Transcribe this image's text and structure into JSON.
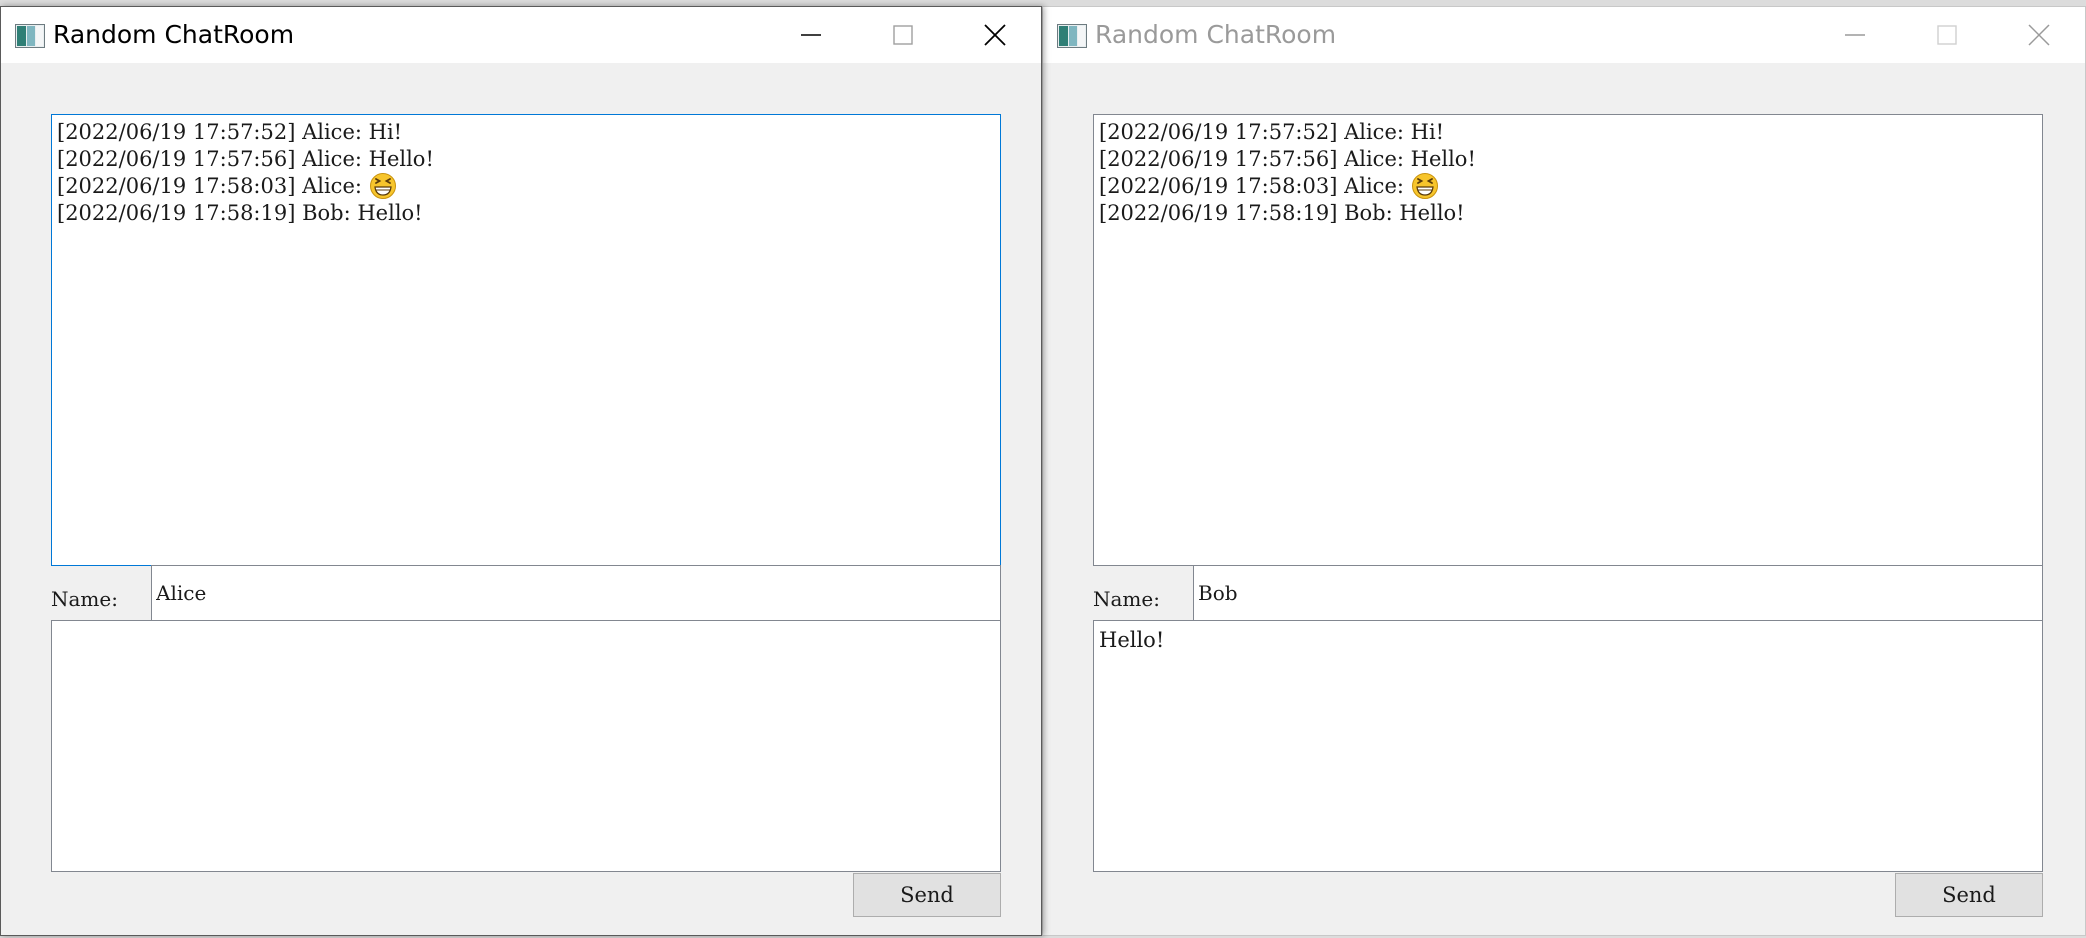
{
  "windows": {
    "alice": {
      "title": "Random ChatRoom",
      "messages": [
        {
          "text": "[2022/06/19 17:57:52] Alice: Hi!"
        },
        {
          "text": "[2022/06/19 17:57:56] Alice: Hello!"
        },
        {
          "text": "[2022/06/19 17:58:03] Alice: ",
          "emoji": "grinning-squinting-face"
        },
        {
          "text": "[2022/06/19 17:58:19] Bob: Hello!"
        }
      ],
      "name_label": "Name:",
      "name_value": "Alice",
      "compose_value": "",
      "send_label": "Send"
    },
    "bob": {
      "title": "Random ChatRoom",
      "messages": [
        {
          "text": "[2022/06/19 17:57:52] Alice: Hi!"
        },
        {
          "text": "[2022/06/19 17:57:56] Alice: Hello!"
        },
        {
          "text": "[2022/06/19 17:58:03] Alice: ",
          "emoji": "grinning-squinting-face"
        },
        {
          "text": "[2022/06/19 17:58:19] Bob: Hello!"
        }
      ],
      "name_label": "Name:",
      "name_value": "Bob",
      "compose_value": "Hello!",
      "send_label": "Send"
    }
  },
  "colors": {
    "focus_border": "#0078d7",
    "inactive_title": "#9a9a9a",
    "window_bg": "#f0f0f0",
    "emoji_yellow": "#f7c52c"
  }
}
